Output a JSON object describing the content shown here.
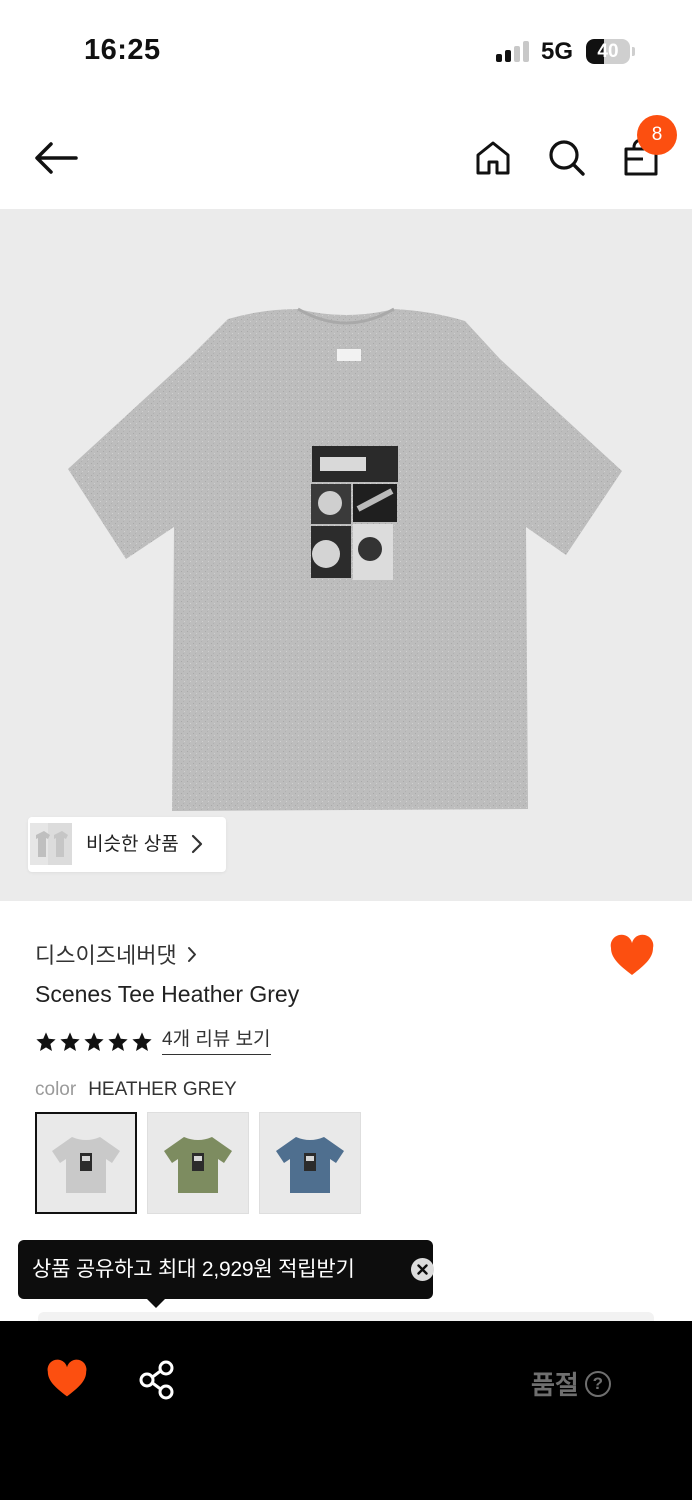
{
  "status_bar": {
    "time": "16:25",
    "network": "5G",
    "battery_percent": "40",
    "battery_level": 0.4,
    "signal_bars_active": 2
  },
  "top_nav": {
    "back_icon": "arrow-left-icon",
    "home_icon": "home-icon",
    "search_icon": "search-icon",
    "cart_icon": "shopping-bag-icon",
    "cart_count": "8"
  },
  "product": {
    "similar_label": "비슷한 상품",
    "brand": "디스이즈네버댓",
    "name": "Scenes Tee Heather Grey",
    "rating_stars": 5,
    "review_link": "4개 리뷰 보기",
    "color_label": "color",
    "color_value": "HEATHER GREY",
    "swatches": [
      {
        "name": "heather-grey",
        "shirt_color": "#c9c9c9",
        "selected": true
      },
      {
        "name": "olive",
        "shirt_color": "#7d8c60",
        "selected": false
      },
      {
        "name": "blue",
        "shirt_color": "#4f6f8f",
        "selected": false
      }
    ]
  },
  "tooltip": {
    "text": "상품 공유하고 최대 2,929원 적립받기"
  },
  "bottom_bar": {
    "status": "품절",
    "help": "?"
  },
  "colors": {
    "accent": "#fc4f10",
    "bottom_bar_bg": "#000000",
    "image_bg": "#ebebeb"
  }
}
